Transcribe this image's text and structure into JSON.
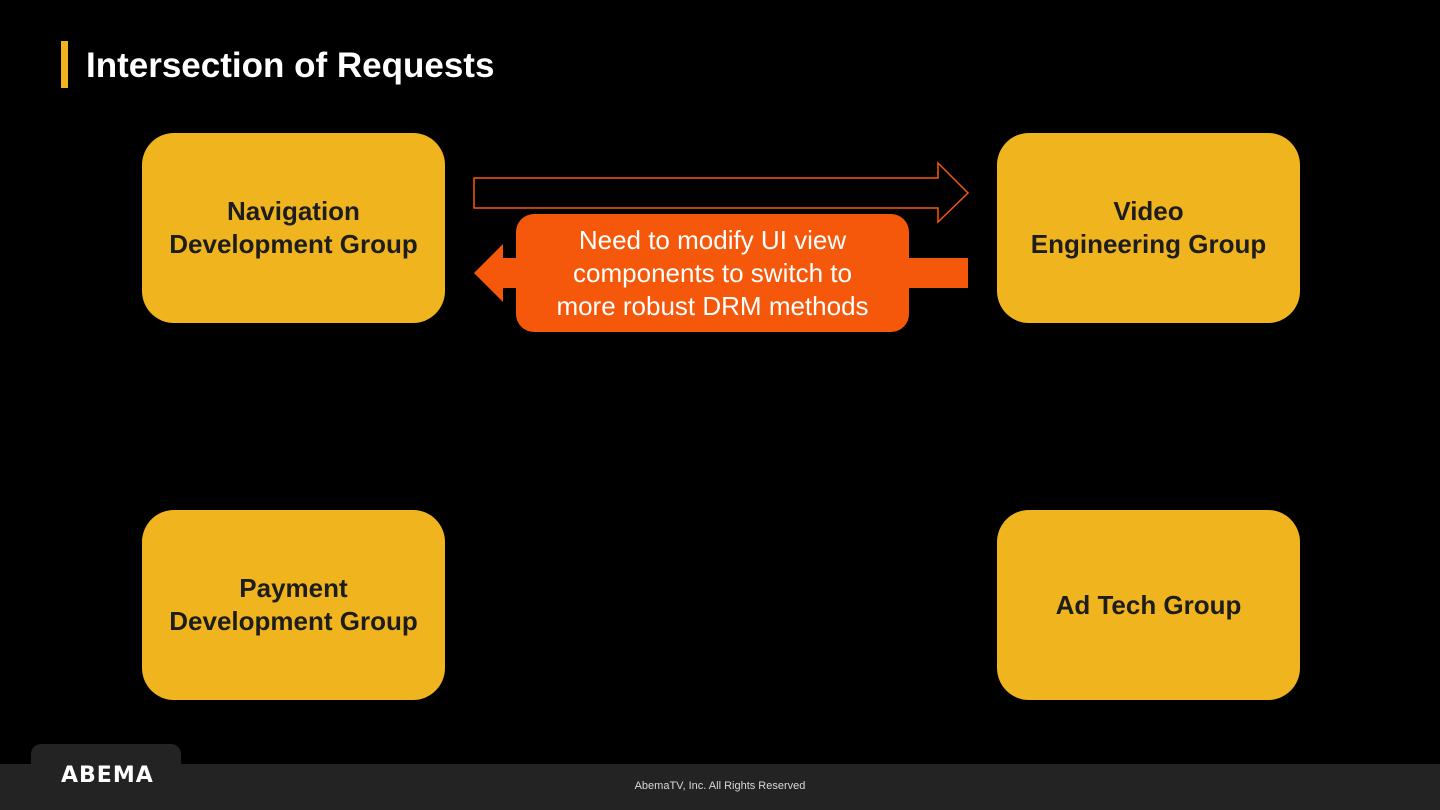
{
  "slide": {
    "title": "Intersection of Requests"
  },
  "nodes": {
    "navigation": {
      "line1": "Navigation",
      "line2": "Development Group"
    },
    "video": {
      "line1": "Video",
      "line2": "Engineering Group"
    },
    "payment": {
      "line1": "Payment",
      "line2": "Development Group"
    },
    "adtech": {
      "line1": "Ad Tech Group"
    }
  },
  "callout": {
    "line1": "Need to modify UI view",
    "line2": "components to switch to",
    "line3": "more robust DRM methods"
  },
  "footer": {
    "logo": "ABEMA",
    "copyright": "AbemaTV, Inc. All Rights Reserved"
  },
  "colors": {
    "background": "#000000",
    "node_fill": "#f0b41e",
    "accent_orange": "#f5580a",
    "footer": "#232323"
  }
}
